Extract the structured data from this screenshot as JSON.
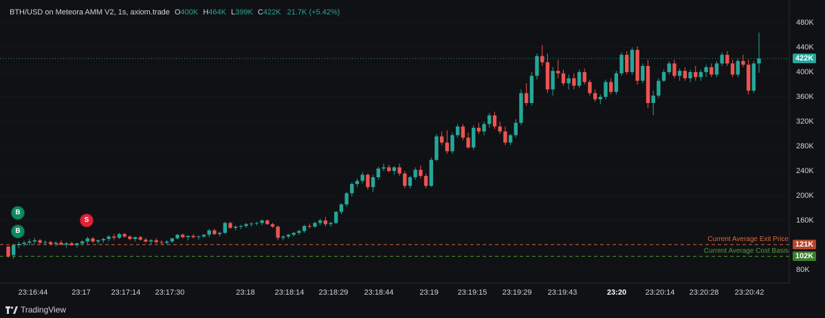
{
  "legend": {
    "title": "BTH/USD on Meteora AMM V2, 1s, axiom.trade",
    "o_label": "O",
    "o_value": "400K",
    "h_label": "H",
    "h_value": "464K",
    "l_label": "L",
    "l_value": "399K",
    "c_label": "C",
    "c_value": "422K",
    "change": "21.7K (+5.42%)"
  },
  "price_axis": {
    "ticks": [
      "480K",
      "440K",
      "400K",
      "360K",
      "320K",
      "280K",
      "240K",
      "200K",
      "160K",
      "80K"
    ],
    "tick_values": [
      480,
      440,
      400,
      360,
      320,
      280,
      240,
      200,
      160,
      80
    ]
  },
  "current_price": {
    "label": "422K",
    "value": 422,
    "color": "#26a69a"
  },
  "exit_line": {
    "text": "Current Average Exit Price",
    "tag": "121K",
    "value": 121,
    "color": "#e0673f"
  },
  "cost_line": {
    "text": "Current Average Cost Basis",
    "tag": "102K",
    "value": 102,
    "color": "#4c9f38"
  },
  "time_axis": {
    "labels": [
      "23:16:44",
      "23:17",
      "23:17:14",
      "23:17:30",
      "23:18",
      "23:18:14",
      "23:18:29",
      "23:18:44",
      "23:19",
      "23:19:15",
      "23:19:29",
      "23:19:43",
      "23:20",
      "23:20:14",
      "23:20:28",
      "23:20:42"
    ],
    "bold_label": "23:20"
  },
  "markers": [
    {
      "type": "buy",
      "text": "B"
    },
    {
      "type": "buy",
      "text": "B"
    },
    {
      "type": "sell",
      "text": "S"
    }
  ],
  "colors": {
    "up": "#26a69a",
    "down": "#ef5350",
    "background": "#101114"
  },
  "footer": {
    "brand": "TradingView",
    "logo": "tradingview-logo-icon"
  },
  "chart_data": {
    "type": "candlestick",
    "unit": "K",
    "ylim": [
      60,
      490
    ],
    "candles": [
      [
        118,
        118,
        100,
        102
      ],
      [
        104,
        122,
        98,
        120
      ],
      [
        120,
        126,
        115,
        122
      ],
      [
        122,
        127,
        118,
        124
      ],
      [
        124,
        130,
        120,
        126
      ],
      [
        126,
        132,
        122,
        128
      ],
      [
        128,
        130,
        122,
        124
      ],
      [
        124,
        128,
        120,
        125
      ],
      [
        125,
        127,
        120,
        122
      ],
      [
        122,
        126,
        118,
        124
      ],
      [
        124,
        128,
        120,
        121
      ],
      [
        121,
        125,
        116,
        123
      ],
      [
        123,
        126,
        119,
        120
      ],
      [
        120,
        124,
        116,
        123
      ],
      [
        123,
        128,
        120,
        126
      ],
      [
        126,
        134,
        122,
        131
      ],
      [
        131,
        133,
        124,
        126
      ],
      [
        126,
        129,
        122,
        128
      ],
      [
        128,
        132,
        124,
        130
      ],
      [
        130,
        136,
        126,
        134
      ],
      [
        134,
        138,
        128,
        132
      ],
      [
        132,
        140,
        130,
        138
      ],
      [
        138,
        140,
        132,
        134
      ],
      [
        134,
        136,
        128,
        130
      ],
      [
        130,
        134,
        126,
        133
      ],
      [
        133,
        135,
        127,
        129
      ],
      [
        129,
        132,
        124,
        126
      ],
      [
        126,
        130,
        122,
        128
      ],
      [
        128,
        131,
        123,
        125
      ],
      [
        125,
        128,
        120,
        124
      ],
      [
        124,
        128,
        121,
        126
      ],
      [
        126,
        132,
        124,
        131
      ],
      [
        131,
        138,
        129,
        137
      ],
      [
        137,
        139,
        131,
        133
      ],
      [
        133,
        136,
        128,
        135
      ],
      [
        135,
        138,
        131,
        133
      ],
      [
        133,
        136,
        129,
        134
      ],
      [
        134,
        138,
        132,
        137
      ],
      [
        137,
        146,
        133,
        144
      ],
      [
        144,
        147,
        136,
        138
      ],
      [
        138,
        142,
        134,
        140
      ],
      [
        140,
        158,
        138,
        156
      ],
      [
        156,
        158,
        146,
        148
      ],
      [
        148,
        152,
        144,
        150
      ],
      [
        150,
        153,
        146,
        151
      ],
      [
        151,
        156,
        148,
        154
      ],
      [
        154,
        157,
        150,
        155
      ],
      [
        155,
        158,
        152,
        156
      ],
      [
        156,
        162,
        152,
        160
      ],
      [
        160,
        162,
        153,
        154
      ],
      [
        154,
        156,
        148,
        150
      ],
      [
        150,
        152,
        128,
        132
      ],
      [
        132,
        136,
        128,
        134
      ],
      [
        134,
        138,
        131,
        137
      ],
      [
        137,
        142,
        134,
        140
      ],
      [
        140,
        145,
        136,
        143
      ],
      [
        143,
        153,
        140,
        151
      ],
      [
        151,
        155,
        147,
        150
      ],
      [
        150,
        158,
        148,
        156
      ],
      [
        156,
        163,
        152,
        160
      ],
      [
        160,
        166,
        150,
        154
      ],
      [
        154,
        158,
        150,
        156
      ],
      [
        156,
        175,
        154,
        174
      ],
      [
        174,
        188,
        170,
        186
      ],
      [
        186,
        206,
        182,
        204
      ],
      [
        204,
        222,
        199,
        219
      ],
      [
        219,
        228,
        214,
        224
      ],
      [
        224,
        238,
        220,
        234
      ],
      [
        234,
        236,
        210,
        214
      ],
      [
        214,
        234,
        206,
        230
      ],
      [
        230,
        247,
        226,
        244
      ],
      [
        244,
        252,
        240,
        246
      ],
      [
        246,
        250,
        238,
        240
      ],
      [
        240,
        248,
        234,
        246
      ],
      [
        246,
        252,
        232,
        236
      ],
      [
        236,
        240,
        212,
        216
      ],
      [
        216,
        232,
        212,
        230
      ],
      [
        230,
        246,
        226,
        242
      ],
      [
        242,
        249,
        228,
        232
      ],
      [
        232,
        236,
        212,
        216
      ],
      [
        216,
        262,
        214,
        258
      ],
      [
        258,
        300,
        256,
        296
      ],
      [
        296,
        304,
        282,
        286
      ],
      [
        286,
        306,
        268,
        272
      ],
      [
        272,
        302,
        268,
        298
      ],
      [
        298,
        316,
        294,
        312
      ],
      [
        312,
        316,
        290,
        294
      ],
      [
        294,
        302,
        276,
        278
      ],
      [
        278,
        314,
        274,
        310
      ],
      [
        310,
        318,
        300,
        304
      ],
      [
        304,
        320,
        298,
        316
      ],
      [
        316,
        334,
        310,
        330
      ],
      [
        330,
        336,
        308,
        312
      ],
      [
        312,
        320,
        300,
        304
      ],
      [
        304,
        312,
        282,
        286
      ],
      [
        286,
        300,
        282,
        298
      ],
      [
        298,
        324,
        294,
        318
      ],
      [
        318,
        372,
        314,
        366
      ],
      [
        366,
        382,
        346,
        350
      ],
      [
        350,
        400,
        346,
        394
      ],
      [
        394,
        430,
        388,
        426
      ],
      [
        426,
        444,
        410,
        416
      ],
      [
        416,
        430,
        366,
        372
      ],
      [
        372,
        408,
        362,
        402
      ],
      [
        402,
        420,
        390,
        398
      ],
      [
        398,
        404,
        378,
        382
      ],
      [
        382,
        396,
        372,
        390
      ],
      [
        390,
        398,
        372,
        378
      ],
      [
        378,
        404,
        374,
        400
      ],
      [
        400,
        406,
        380,
        384
      ],
      [
        384,
        388,
        362,
        366
      ],
      [
        366,
        372,
        352,
        356
      ],
      [
        356,
        364,
        348,
        360
      ],
      [
        360,
        388,
        356,
        384
      ],
      [
        384,
        390,
        364,
        368
      ],
      [
        368,
        402,
        364,
        398
      ],
      [
        398,
        432,
        394,
        428
      ],
      [
        428,
        434,
        396,
        400
      ],
      [
        400,
        440,
        396,
        436
      ],
      [
        436,
        442,
        380,
        386
      ],
      [
        386,
        414,
        382,
        410
      ],
      [
        410,
        420,
        342,
        350
      ],
      [
        350,
        370,
        330,
        362
      ],
      [
        362,
        390,
        358,
        386
      ],
      [
        386,
        404,
        384,
        400
      ],
      [
        400,
        418,
        396,
        414
      ],
      [
        414,
        420,
        390,
        394
      ],
      [
        394,
        406,
        386,
        402
      ],
      [
        402,
        408,
        386,
        390
      ],
      [
        390,
        404,
        384,
        400
      ],
      [
        400,
        410,
        386,
        392
      ],
      [
        392,
        404,
        386,
        400
      ],
      [
        400,
        412,
        392,
        408
      ],
      [
        408,
        414,
        392,
        396
      ],
      [
        396,
        418,
        392,
        414
      ],
      [
        414,
        432,
        410,
        428
      ],
      [
        428,
        434,
        410,
        414
      ],
      [
        414,
        420,
        392,
        396
      ],
      [
        396,
        422,
        392,
        418
      ],
      [
        418,
        428,
        408,
        412
      ],
      [
        412,
        420,
        364,
        370
      ],
      [
        370,
        418,
        366,
        414
      ],
      [
        414,
        464,
        399,
        422
      ]
    ]
  }
}
